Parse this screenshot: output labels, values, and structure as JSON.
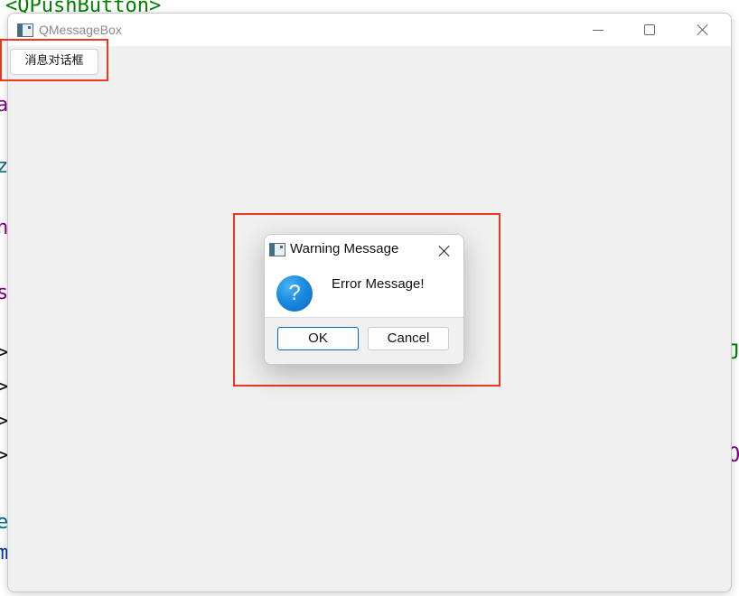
{
  "background_code": {
    "top_snippet": "<QPushButton>",
    "left_fragments": [
      "a",
      "z",
      "n",
      "s",
      ">",
      ">",
      ">",
      ">",
      "e",
      "m"
    ],
    "right_fragments": [
      "J",
      "O"
    ]
  },
  "main_window": {
    "title": "QMessageBox",
    "icon": "qt-app-icon",
    "controls": [
      "minimize-icon",
      "maximize-icon",
      "close-icon"
    ],
    "push_button_label": "消息对话框"
  },
  "dialog": {
    "title": "Warning Message",
    "icon": "question-icon",
    "message": "Error Message!",
    "ok_label": "OK",
    "cancel_label": "Cancel"
  },
  "colors": {
    "highlight_box": "#e8381e",
    "question_icon": "#1a8ce0",
    "default_button_border": "#0067c0",
    "code_green": "#008000",
    "code_purple": "#800080",
    "code_teal": "#006e8a"
  }
}
